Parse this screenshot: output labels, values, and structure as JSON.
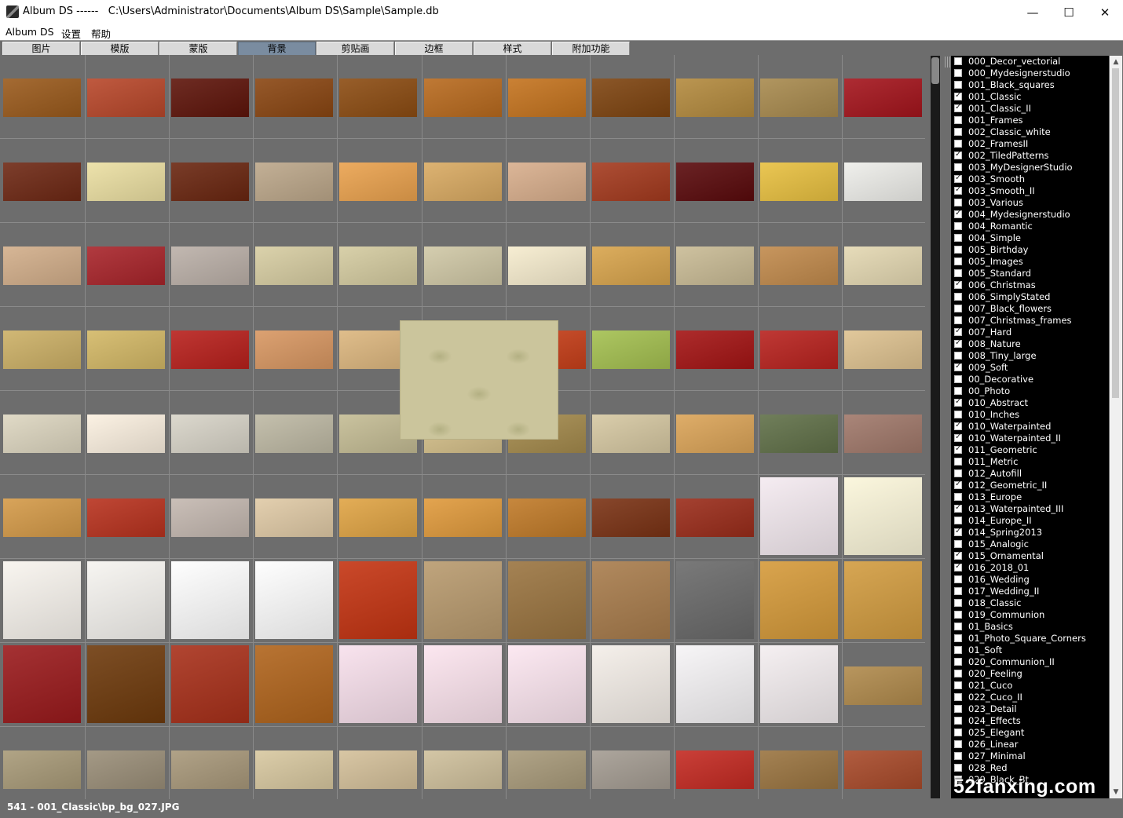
{
  "window": {
    "app_name": "Album DS ------",
    "path": "C:\\Users\\Administrator\\Documents\\Album DS\\Sample\\Sample.db",
    "minimize_glyph": "—",
    "maximize_glyph": "☐",
    "close_glyph": "✕"
  },
  "menu": [
    "Album DS",
    "设置",
    "帮助"
  ],
  "tabs": [
    {
      "label": "图片",
      "active": false
    },
    {
      "label": "模版",
      "active": false
    },
    {
      "label": "蒙版",
      "active": false
    },
    {
      "label": "背景",
      "active": true
    },
    {
      "label": "剪贴画",
      "active": false
    },
    {
      "label": "边框",
      "active": false
    },
    {
      "label": "样式",
      "active": false
    },
    {
      "label": "附加功能",
      "active": false
    }
  ],
  "thumbnail_colors": [
    [
      "#9a5a1c",
      "#b8472a",
      "#5e140a",
      "#8a4612",
      "#8c4c12",
      "#b86a1e",
      "#c4731e",
      "#7e4410",
      "#b38a3e",
      "#a88a4e",
      "#a4141c"
    ],
    [
      "#6e2814",
      "#ebdfa2",
      "#6a2610",
      "#bca78a",
      "#eaa24e",
      "#d9aa62",
      "#d8ae8c",
      "#a43a1e",
      "#5a0a0c",
      "#e8c040",
      "#eeeeea"
    ],
    [
      "#d2ae8a",
      "#a8242a",
      "#bbb0a8",
      "#d7cda2",
      "#d4cba0",
      "#d0c8a6",
      "#f6ecce",
      "#d8a44c",
      "#c9bb95",
      "#c18a4c",
      "#e4d8b2"
    ],
    [
      "#ccb066",
      "#d3b866",
      "#b8201c",
      "#d89762",
      "#dcb67e",
      "#000000",
      "#c8401a",
      "#a4c050",
      "#a41414",
      "#b8221e",
      "#dec290"
    ],
    [
      "#ddd6c0",
      "#fbf0e0",
      "#d8d4c8",
      "#beb9a4",
      "#c4bc94",
      "#d5c08a",
      "#a48a4c",
      "#d6c8a2",
      "#dba458",
      "#607048",
      "#a0786a"
    ],
    [
      "#d49a48",
      "#b8321e",
      "#c4b8b0",
      "#e0caa6",
      "#e0a444",
      "#e09a3c",
      "#c07a28",
      "#7a3214",
      "#9a2c1a",
      "#f4eaf0",
      "#fbf6da"
    ],
    [
      "#f8f4ee",
      "#f6f4f0",
      "#fefefe",
      "#fefefe",
      "#c43412",
      "#b89a6e",
      "#9a7440",
      "#a87c4c",
      "#6a6a6a",
      "#d59a3a",
      "#d29c40"
    ],
    [
      "#9a1a1c",
      "#6e3a0c",
      "#a8301a",
      "#b0641c",
      "#f8e0ec",
      "#fce4ee",
      "#fce6f0",
      "#f4eee8",
      "#f6f4f6",
      "#f4eef0",
      "#b08a4c"
    ],
    [
      "#a89a78",
      "#9a8e78",
      "#a8987a",
      "#d8c8a0",
      "#d4c09a",
      "#cfc09c",
      "#a89a7a",
      "#a49c92",
      "#c42a22",
      "#9a7440",
      "#a84a2a"
    ]
  ],
  "preview_visible": true,
  "collections": [
    {
      "name": "000_Decor_vectorial",
      "checked": false
    },
    {
      "name": "000_Mydesignerstudio",
      "checked": false
    },
    {
      "name": "001_Black_squares",
      "checked": false
    },
    {
      "name": "001_Classic",
      "checked": true
    },
    {
      "name": "001_Classic_II",
      "checked": true
    },
    {
      "name": "001_Frames",
      "checked": false
    },
    {
      "name": "002_Classic_white",
      "checked": false
    },
    {
      "name": "002_FramesII",
      "checked": false
    },
    {
      "name": "002_TiledPatterns",
      "checked": true
    },
    {
      "name": "003_MyDesignerStudio",
      "checked": false
    },
    {
      "name": "003_Smooth",
      "checked": true
    },
    {
      "name": "003_Smooth_II",
      "checked": true
    },
    {
      "name": "003_Various",
      "checked": false
    },
    {
      "name": "004_Mydesignerstudio",
      "checked": true
    },
    {
      "name": "004_Romantic",
      "checked": false
    },
    {
      "name": "004_Simple",
      "checked": false
    },
    {
      "name": "005_Birthday",
      "checked": false
    },
    {
      "name": "005_Images",
      "checked": false
    },
    {
      "name": "005_Standard",
      "checked": false
    },
    {
      "name": "006_Christmas",
      "checked": true
    },
    {
      "name": "006_SimplyStated",
      "checked": false
    },
    {
      "name": "007_Black_flowers",
      "checked": false
    },
    {
      "name": "007_Christmas_frames",
      "checked": false
    },
    {
      "name": "007_Hard",
      "checked": true
    },
    {
      "name": "008_Nature",
      "checked": true
    },
    {
      "name": "008_Tiny_large",
      "checked": false
    },
    {
      "name": "009_Soft",
      "checked": true
    },
    {
      "name": "00_Decorative",
      "checked": false
    },
    {
      "name": "00_Photo",
      "checked": false
    },
    {
      "name": "010_Abstract",
      "checked": true
    },
    {
      "name": "010_Inches",
      "checked": false
    },
    {
      "name": "010_Waterpainted",
      "checked": true
    },
    {
      "name": "010_Waterpainted_II",
      "checked": true
    },
    {
      "name": "011_Geometric",
      "checked": true
    },
    {
      "name": "011_Metric",
      "checked": false
    },
    {
      "name": "012_Autofill",
      "checked": false
    },
    {
      "name": "012_Geometric_II",
      "checked": true
    },
    {
      "name": "013_Europe",
      "checked": false
    },
    {
      "name": "013_Waterpainted_III",
      "checked": true
    },
    {
      "name": "014_Europe_II",
      "checked": false
    },
    {
      "name": "014_Spring2013",
      "checked": true
    },
    {
      "name": "015_Analogic",
      "checked": false
    },
    {
      "name": "015_Ornamental",
      "checked": true
    },
    {
      "name": "016_2018_01",
      "checked": true
    },
    {
      "name": "016_Wedding",
      "checked": false
    },
    {
      "name": "017_Wedding_II",
      "checked": false
    },
    {
      "name": "018_Classic",
      "checked": false
    },
    {
      "name": "019_Communion",
      "checked": false
    },
    {
      "name": "01_Basics",
      "checked": false
    },
    {
      "name": "01_Photo_Square_Corners",
      "checked": false
    },
    {
      "name": "01_Soft",
      "checked": false
    },
    {
      "name": "020_Communion_II",
      "checked": false
    },
    {
      "name": "020_Feeling",
      "checked": false
    },
    {
      "name": "021_Cuco",
      "checked": false
    },
    {
      "name": "022_Cuco_II",
      "checked": false
    },
    {
      "name": "023_Detail",
      "checked": false
    },
    {
      "name": "024_Effects",
      "checked": false
    },
    {
      "name": "025_Elegant",
      "checked": false
    },
    {
      "name": "026_Linear",
      "checked": false
    },
    {
      "name": "027_Minimal",
      "checked": false
    },
    {
      "name": "028_Red",
      "checked": false
    },
    {
      "name": "029_Black_Bt",
      "checked": false
    }
  ],
  "status": "541 - 001_Classic\\bp_bg_027.JPG",
  "watermark": "52fanxing.com"
}
